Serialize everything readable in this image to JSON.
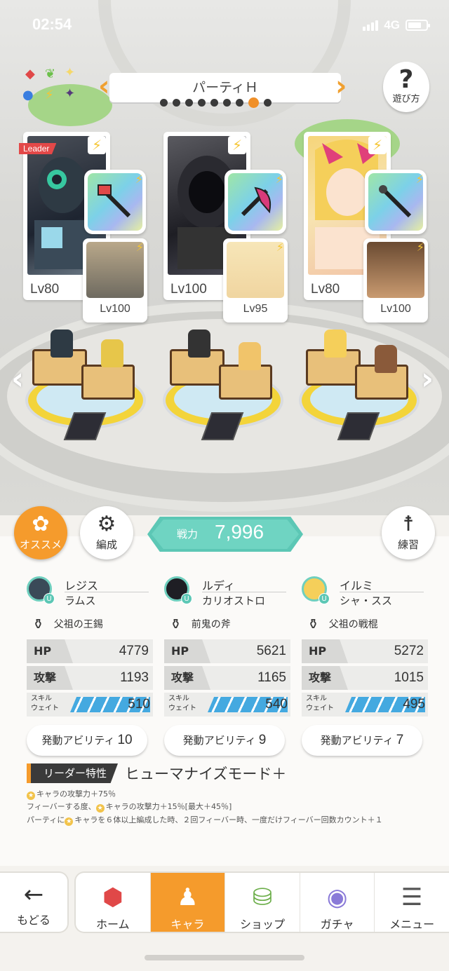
{
  "status_bar": {
    "time": "02:54",
    "network": "4G"
  },
  "party": {
    "title": "パーティＨ",
    "page_count": 9,
    "active_page": 8
  },
  "help": {
    "label": "遊び方"
  },
  "leader_tag": "Leader",
  "cards": [
    {
      "main_level": "Lv80",
      "sub_level": "Lv100"
    },
    {
      "main_level": "Lv100",
      "sub_level": "Lv95"
    },
    {
      "main_level": "Lv80",
      "sub_level": "Lv100"
    }
  ],
  "buttons": {
    "recommend": "オススメ",
    "formation": "編成",
    "practice": "練習"
  },
  "power": {
    "label": "戦力",
    "value": "7,996"
  },
  "members": [
    {
      "name": "レジス",
      "sub": "ラムス",
      "weapon": "父祖の王錫",
      "hp": "4779",
      "atk": "1193",
      "skill_wait": "510",
      "ability_label": "発動アビリティ",
      "ability_count": "10"
    },
    {
      "name": "ルディ",
      "sub": "カリオストロ",
      "weapon": "前鬼の斧",
      "hp": "5621",
      "atk": "1165",
      "skill_wait": "540",
      "ability_label": "発動アビリティ",
      "ability_count": "9"
    },
    {
      "name": "イルミ",
      "sub": "シャ・スス",
      "weapon": "父祖の戦棍",
      "hp": "5272",
      "atk": "1015",
      "skill_wait": "495",
      "ability_label": "発動アビリティ",
      "ability_count": "7"
    }
  ],
  "stat_labels": {
    "hp": "HP",
    "atk": "攻撃",
    "skill_line1": "スキル",
    "skill_line2": "ウェイト"
  },
  "leader_skill": {
    "tag": "リーダー特性",
    "name": "ヒューマナイズモード＋",
    "lines": [
      "キャラの攻撃力＋75％",
      "フィーバーする度、",
      "キャラの攻撃力＋15％[最大＋45％]",
      "パーティに",
      "キャラを６体以上編成した時、２回フィーバー時、一度だけフィーバー回数カウント＋１"
    ]
  },
  "nav": {
    "back": "もどる",
    "tabs": [
      "ホーム",
      "キャラ",
      "ショップ",
      "ガチャ",
      "メニュー"
    ],
    "active_tab": "キャラ"
  },
  "colors": {
    "accent": "#f59b2c",
    "teal": "#5cc7b5",
    "skill_bar": "#44a9e0"
  }
}
